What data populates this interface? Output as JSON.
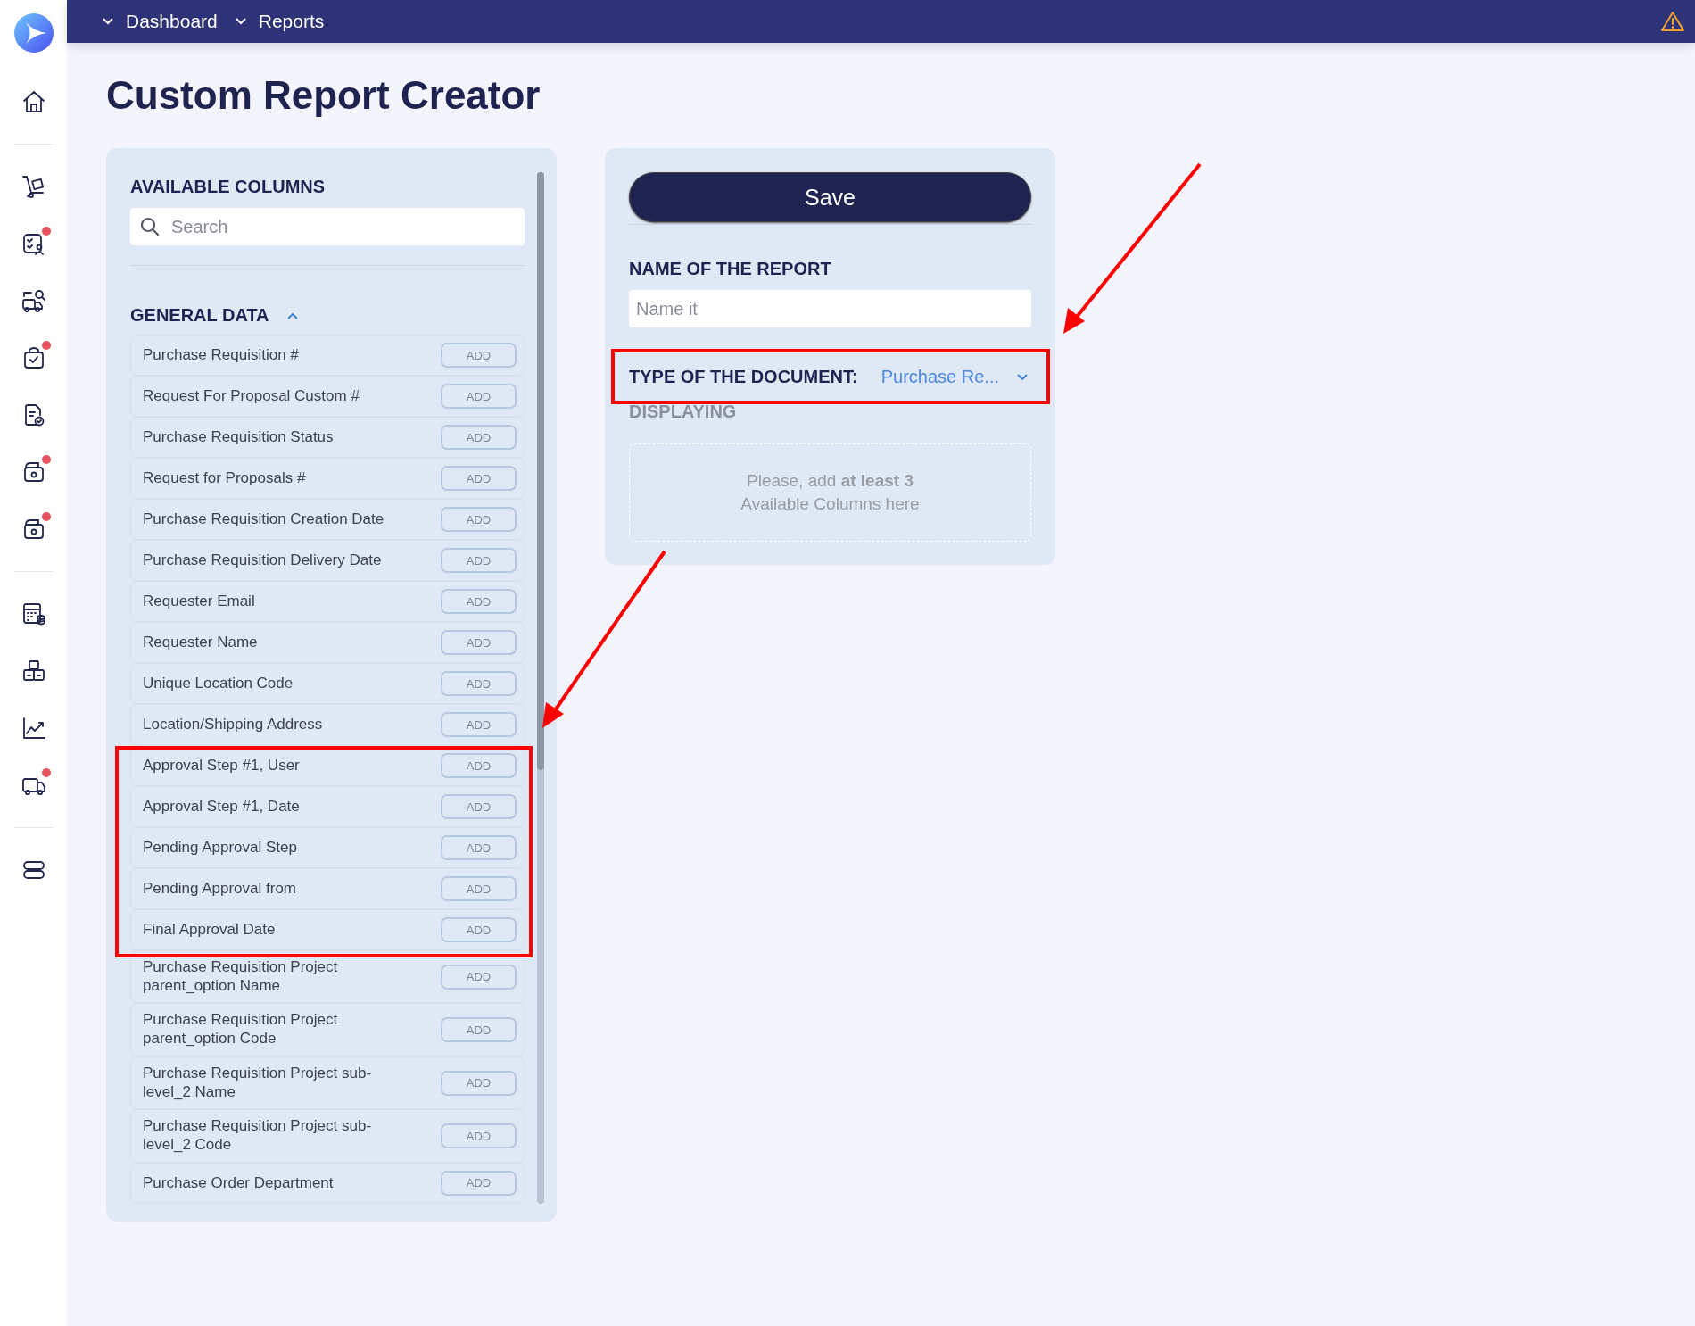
{
  "topbar": {
    "breadcrumbs": [
      {
        "label": "Dashboard"
      },
      {
        "label": "Reports"
      }
    ],
    "warning": true
  },
  "sidebar": {
    "groups": [
      [
        {
          "kind": "home",
          "badge": false
        }
      ],
      [
        {
          "kind": "cart",
          "badge": false
        },
        {
          "kind": "checklist",
          "badge": true
        },
        {
          "kind": "truck-search",
          "badge": false
        },
        {
          "kind": "bag",
          "badge": true
        },
        {
          "kind": "doc-check",
          "badge": false
        },
        {
          "kind": "camera-doc",
          "badge": true
        },
        {
          "kind": "camera-doc",
          "badge": true
        }
      ],
      [
        {
          "kind": "calculator",
          "badge": false
        },
        {
          "kind": "boxes",
          "badge": false
        },
        {
          "kind": "chart",
          "badge": false
        },
        {
          "kind": "truck",
          "badge": true
        }
      ],
      [
        {
          "kind": "toggle",
          "badge": false
        }
      ]
    ]
  },
  "page_title": "Custom Report Creator",
  "available_columns": {
    "title": "AVAILABLE COLUMNS",
    "search": {
      "placeholder": "Search"
    },
    "section": {
      "title": "GENERAL DATA",
      "expanded": true
    },
    "items": [
      {
        "label": "Purchase Requisition #",
        "button": "ADD"
      },
      {
        "label": "Request For Proposal Custom #",
        "button": "ADD"
      },
      {
        "label": "Purchase Requisition Status",
        "button": "ADD"
      },
      {
        "label": "Request for Proposals #",
        "button": "ADD"
      },
      {
        "label": "Purchase Requisition Creation Date",
        "button": "ADD"
      },
      {
        "label": "Purchase Requisition Delivery Date",
        "button": "ADD"
      },
      {
        "label": "Requester Email",
        "button": "ADD"
      },
      {
        "label": "Requester Name",
        "button": "ADD"
      },
      {
        "label": "Unique Location Code",
        "button": "ADD"
      },
      {
        "label": "Location/Shipping Address",
        "button": "ADD"
      },
      {
        "label": "Approval Step #1, User",
        "button": "ADD"
      },
      {
        "label": "Approval Step #1, Date",
        "button": "ADD"
      },
      {
        "label": "Pending Approval Step",
        "button": "ADD"
      },
      {
        "label": "Pending Approval from",
        "button": "ADD"
      },
      {
        "label": "Final Approval Date",
        "button": "ADD"
      },
      {
        "label": "Purchase Requisition Project parent_option Name",
        "button": "ADD"
      },
      {
        "label": "Purchase Requisition Project parent_option Code",
        "button": "ADD"
      },
      {
        "label": "Purchase Requisition Project sub-level_2 Name",
        "button": "ADD"
      },
      {
        "label": "Purchase Requisition Project sub-level_2 Code",
        "button": "ADD"
      },
      {
        "label": "Purchase Order Department",
        "button": "ADD"
      }
    ]
  },
  "report": {
    "save_button": "Save",
    "name_label": "NAME OF THE REPORT",
    "name_field": {
      "placeholder": "Name it"
    },
    "type_label": "TYPE OF THE DOCUMENT:",
    "type_value": "Purchase Re...",
    "displaying_label": "DISPLAYING",
    "drop_hint": [
      "Please, add **at least 3**",
      "Available Columns here"
    ]
  }
}
